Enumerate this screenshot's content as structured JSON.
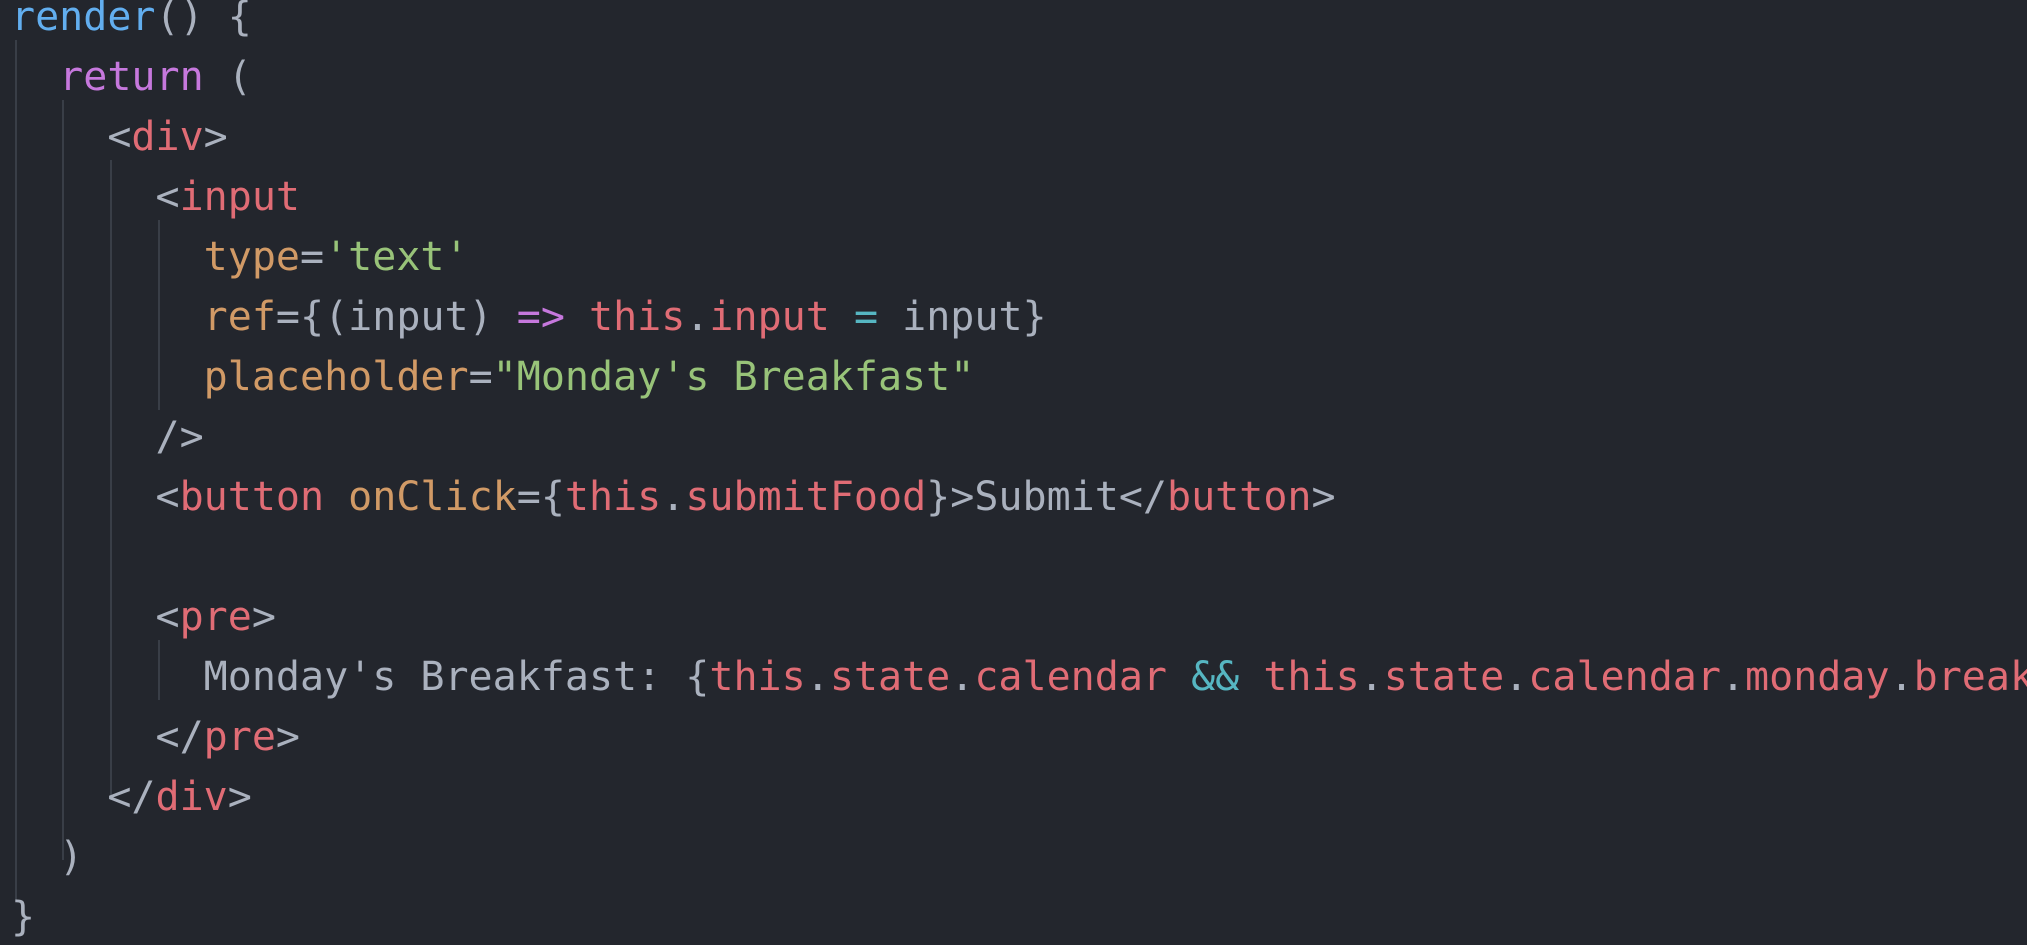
{
  "lines": [
    [
      {
        "t": "render",
        "c": "fn"
      },
      {
        "t": "() {",
        "c": "txt"
      }
    ],
    [
      {
        "t": "  ",
        "c": "txt"
      },
      {
        "t": "return",
        "c": "kw"
      },
      {
        "t": " (",
        "c": "txt"
      }
    ],
    [
      {
        "t": "    <",
        "c": "txt"
      },
      {
        "t": "div",
        "c": "tag"
      },
      {
        "t": ">",
        "c": "txt"
      }
    ],
    [
      {
        "t": "      <",
        "c": "txt"
      },
      {
        "t": "input",
        "c": "tag"
      }
    ],
    [
      {
        "t": "        ",
        "c": "txt"
      },
      {
        "t": "type",
        "c": "attr"
      },
      {
        "t": "=",
        "c": "txt"
      },
      {
        "t": "'text'",
        "c": "str"
      }
    ],
    [
      {
        "t": "        ",
        "c": "txt"
      },
      {
        "t": "ref",
        "c": "attr"
      },
      {
        "t": "={(input) ",
        "c": "txt"
      },
      {
        "t": "=>",
        "c": "kw"
      },
      {
        "t": " ",
        "c": "txt"
      },
      {
        "t": "this",
        "c": "tag"
      },
      {
        "t": ".",
        "c": "txt"
      },
      {
        "t": "input",
        "c": "tag"
      },
      {
        "t": " ",
        "c": "txt"
      },
      {
        "t": "=",
        "c": "op"
      },
      {
        "t": " input}",
        "c": "txt"
      }
    ],
    [
      {
        "t": "        ",
        "c": "txt"
      },
      {
        "t": "placeholder",
        "c": "attr"
      },
      {
        "t": "=",
        "c": "txt"
      },
      {
        "t": "\"Monday's Breakfast\"",
        "c": "str"
      }
    ],
    [
      {
        "t": "      />",
        "c": "txt"
      }
    ],
    [
      {
        "t": "      <",
        "c": "txt"
      },
      {
        "t": "button",
        "c": "tag"
      },
      {
        "t": " ",
        "c": "txt"
      },
      {
        "t": "onClick",
        "c": "attr"
      },
      {
        "t": "={",
        "c": "txt"
      },
      {
        "t": "this",
        "c": "tag"
      },
      {
        "t": ".",
        "c": "txt"
      },
      {
        "t": "submitFood",
        "c": "tag"
      },
      {
        "t": "}>Submit</",
        "c": "txt"
      },
      {
        "t": "button",
        "c": "tag"
      },
      {
        "t": ">",
        "c": "txt"
      }
    ],
    [],
    [
      {
        "t": "      <",
        "c": "txt"
      },
      {
        "t": "pre",
        "c": "tag"
      },
      {
        "t": ">",
        "c": "txt"
      }
    ],
    [
      {
        "t": "        Monday's Breakfast: {",
        "c": "txt"
      },
      {
        "t": "this",
        "c": "tag"
      },
      {
        "t": ".",
        "c": "txt"
      },
      {
        "t": "state",
        "c": "tag"
      },
      {
        "t": ".",
        "c": "txt"
      },
      {
        "t": "calendar",
        "c": "tag"
      },
      {
        "t": " ",
        "c": "txt"
      },
      {
        "t": "&&",
        "c": "op"
      },
      {
        "t": " ",
        "c": "txt"
      },
      {
        "t": "this",
        "c": "tag"
      },
      {
        "t": ".",
        "c": "txt"
      },
      {
        "t": "state",
        "c": "tag"
      },
      {
        "t": ".",
        "c": "txt"
      },
      {
        "t": "calendar",
        "c": "tag"
      },
      {
        "t": ".",
        "c": "txt"
      },
      {
        "t": "monday",
        "c": "tag"
      },
      {
        "t": ".",
        "c": "txt"
      },
      {
        "t": "break",
        "c": "tag"
      }
    ],
    [
      {
        "t": "      </",
        "c": "txt"
      },
      {
        "t": "pre",
        "c": "tag"
      },
      {
        "t": ">",
        "c": "txt"
      }
    ],
    [
      {
        "t": "    </",
        "c": "txt"
      },
      {
        "t": "div",
        "c": "tag"
      },
      {
        "t": ">",
        "c": "txt"
      }
    ],
    [
      {
        "t": "  )",
        "c": "txt"
      }
    ],
    [
      {
        "t": "}",
        "c": "txt"
      }
    ]
  ],
  "colors": {
    "background": "#23262d",
    "text": "#aab1be",
    "function": "#62aeef",
    "keyword": "#c678dd",
    "tag": "#e06c75",
    "attribute": "#d19a66",
    "string": "#98c379",
    "operator": "#56b6c2",
    "indent_guide": "#393e47"
  }
}
